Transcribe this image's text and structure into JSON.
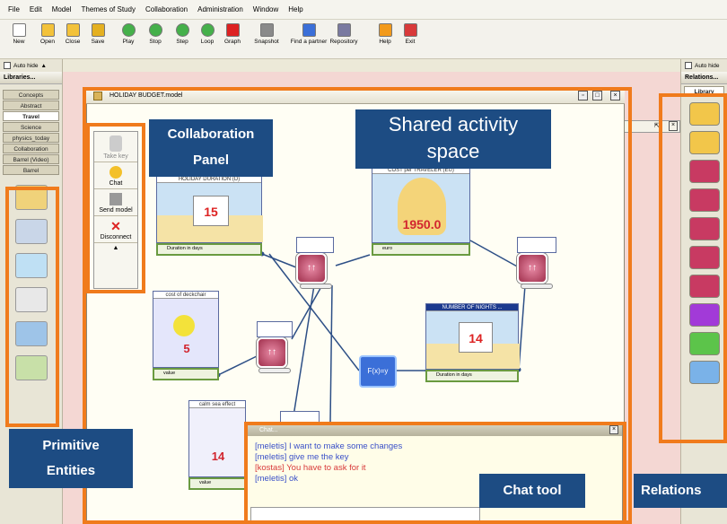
{
  "menu": [
    "File",
    "Edit",
    "Model",
    "Themes of Study",
    "Collaboration",
    "Administration",
    "Window",
    "Help"
  ],
  "toolbar": [
    {
      "label": "New",
      "icon": "new-icon"
    },
    {
      "label": "Open",
      "icon": "open-icon"
    },
    {
      "label": "Close",
      "icon": "close-icon"
    },
    {
      "label": "Save",
      "icon": "save-icon"
    },
    {
      "label": "Play",
      "icon": "play-icon"
    },
    {
      "label": "Stop",
      "icon": "stop-icon"
    },
    {
      "label": "Step",
      "icon": "step-icon"
    },
    {
      "label": "Loop",
      "icon": "loop-icon"
    },
    {
      "label": "Graph",
      "icon": "graph-icon"
    },
    {
      "label": "Snapshot",
      "icon": "snapshot-icon"
    },
    {
      "label": "Find a partner",
      "icon": "find-partner-icon"
    },
    {
      "label": "Repository",
      "icon": "repository-icon"
    },
    {
      "label": "Help",
      "icon": "help-icon"
    },
    {
      "label": "Exit",
      "icon": "exit-icon"
    }
  ],
  "left": {
    "autohide": "Auto hide",
    "title": "Libraries...",
    "tabs": [
      "Concepts",
      "Abstract",
      "Travel",
      "Science",
      "physics_today",
      "Collaboration",
      "Barrel (Video)",
      "Barrel"
    ]
  },
  "right": {
    "autohide": "Auto hide",
    "title": "Relations...",
    "tab": "Library"
  },
  "model": {
    "title": "HOLIDAY BUDGET.model",
    "tiles": {
      "duration": {
        "caption": "HOLIDAY DURATION (D)",
        "value": "15",
        "slider": "Duration in days"
      },
      "cost": {
        "caption": "COST per TRAVELER (EU)",
        "value": "1950.0",
        "slider": "euro"
      },
      "nights": {
        "caption": "NUMBER OF NIGHTS ...",
        "value": "14",
        "slider": "Duration in days"
      },
      "deck": {
        "caption": "cost of deckchair",
        "value": "5",
        "slider": "value"
      },
      "calm": {
        "caption": "calm sea effect",
        "value": "14",
        "slider": "value"
      }
    },
    "fx": "F(x)=y"
  },
  "collab": {
    "items": [
      "Take key",
      "Chat",
      "Send model",
      "Disconnect"
    ],
    "arrow": "▲"
  },
  "chat": {
    "title": "Chat...",
    "messages": [
      {
        "text": "[meletis] I want to make some changes",
        "color": "#3a50c8"
      },
      {
        "text": "[meletis] give me the key",
        "color": "#3a50c8"
      },
      {
        "text": "[kostas] You have to ask for it",
        "color": "#d83a3a"
      },
      {
        "text": "[meletis] ok",
        "color": "#3a50c8"
      }
    ]
  },
  "labels": {
    "collab1": "Collaboration",
    "collab2": "Panel",
    "shared1": "Shared activity",
    "shared2": "space",
    "prim1": "Primitive",
    "prim2": "Entities",
    "chat": "Chat tool",
    "relations": "Relations"
  },
  "colors": {
    "highlight": "#f07b1c",
    "label_bg": "#1d4c83",
    "tile_border": "#5a6aa0"
  }
}
